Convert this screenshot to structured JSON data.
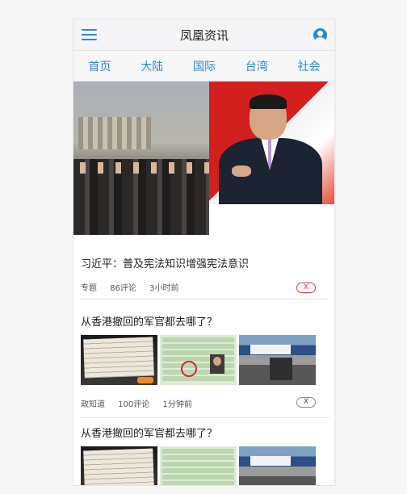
{
  "header": {
    "title": "凤凰资讯"
  },
  "nav": {
    "items": [
      "首页",
      "大陆",
      "国际",
      "台湾",
      "社会"
    ]
  },
  "articles": [
    {
      "title": "习近平：普及宪法知识增强宪法意识",
      "tag": "专题",
      "comments": "86评论",
      "time": "3小时前",
      "close": "X"
    },
    {
      "title": "从香港撤回的军官都去哪了？",
      "tag": "政知道",
      "comments": "100评论",
      "time": "1分钟前",
      "close": "X"
    },
    {
      "title": "从香港撤回的军官都去哪了？"
    }
  ],
  "colors": {
    "accent": "#2a86d8",
    "close_red": "#e0393e"
  },
  "icons": {
    "menu": "hamburger-menu-icon",
    "user": "user-account-icon",
    "close": "close-icon"
  }
}
